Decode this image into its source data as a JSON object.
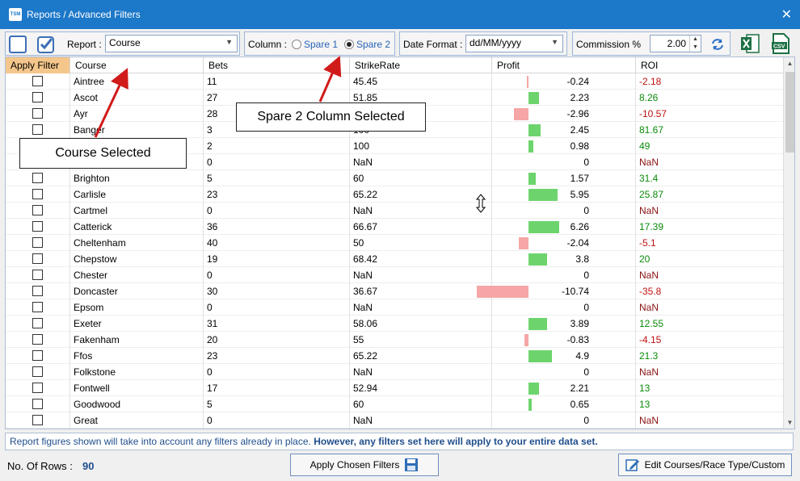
{
  "window": {
    "app_icon": "TSM",
    "title": "Reports / Advanced Filters",
    "close": "✕"
  },
  "toolbar": {
    "report_label": "Report :",
    "report_value": "Course",
    "column_label": "Column :",
    "spare1": "Spare 1",
    "spare2": "Spare 2",
    "date_format_label": "Date Format :",
    "date_format_value": "dd/MM/yyyy",
    "commission_label": "Commission %",
    "commission_value": "2.00"
  },
  "grid": {
    "headers": [
      "Apply Filter",
      "Course",
      "Bets",
      "StrikeRate",
      "Profit",
      "ROI"
    ],
    "rows": [
      {
        "course": "Aintree",
        "bets": "11",
        "strike": "45.45",
        "profit": -0.24,
        "profit_text": "-0.24",
        "roi": "-2.18"
      },
      {
        "course": "Ascot",
        "bets": "27",
        "strike": "51.85",
        "profit": 2.23,
        "profit_text": "2.23",
        "roi": "8.26"
      },
      {
        "course": "Ayr",
        "bets": "28",
        "strike": "",
        "profit": -2.96,
        "profit_text": "-2.96",
        "roi": "-10.57"
      },
      {
        "course": "Banger",
        "bets": "3",
        "strike": "100",
        "profit": 2.45,
        "profit_text": "2.45",
        "roi": "81.67"
      },
      {
        "course": "",
        "bets": "2",
        "strike": "100",
        "profit": 0.98,
        "profit_text": "0.98",
        "roi": "49"
      },
      {
        "course": "",
        "bets": "0",
        "strike": "NaN",
        "profit": 0,
        "profit_text": "0",
        "roi": "NaN"
      },
      {
        "course": "Brighton",
        "bets": "5",
        "strike": "60",
        "profit": 1.57,
        "profit_text": "1.57",
        "roi": "31.4"
      },
      {
        "course": "Carlisle",
        "bets": "23",
        "strike": "65.22",
        "profit": 5.95,
        "profit_text": "5.95",
        "roi": "25.87"
      },
      {
        "course": "Cartmel",
        "bets": "0",
        "strike": "NaN",
        "profit": 0,
        "profit_text": "0",
        "roi": "NaN"
      },
      {
        "course": "Catterick",
        "bets": "36",
        "strike": "66.67",
        "profit": 6.26,
        "profit_text": "6.26",
        "roi": "17.39"
      },
      {
        "course": "Cheltenham",
        "bets": "40",
        "strike": "50",
        "profit": -2.04,
        "profit_text": "-2.04",
        "roi": "-5.1"
      },
      {
        "course": "Chepstow",
        "bets": "19",
        "strike": "68.42",
        "profit": 3.8,
        "profit_text": "3.8",
        "roi": "20"
      },
      {
        "course": "Chester",
        "bets": "0",
        "strike": "NaN",
        "profit": 0,
        "profit_text": "0",
        "roi": "NaN"
      },
      {
        "course": "Doncaster",
        "bets": "30",
        "strike": "36.67",
        "profit": -10.74,
        "profit_text": "-10.74",
        "roi": "-35.8"
      },
      {
        "course": "Epsom",
        "bets": "0",
        "strike": "NaN",
        "profit": 0,
        "profit_text": "0",
        "roi": "NaN"
      },
      {
        "course": "Exeter",
        "bets": "31",
        "strike": "58.06",
        "profit": 3.89,
        "profit_text": "3.89",
        "roi": "12.55"
      },
      {
        "course": "Fakenham",
        "bets": "20",
        "strike": "55",
        "profit": -0.83,
        "profit_text": "-0.83",
        "roi": "-4.15"
      },
      {
        "course": "Ffos",
        "bets": "23",
        "strike": "65.22",
        "profit": 4.9,
        "profit_text": "4.9",
        "roi": "21.3"
      },
      {
        "course": "Folkstone",
        "bets": "0",
        "strike": "NaN",
        "profit": 0,
        "profit_text": "0",
        "roi": "NaN"
      },
      {
        "course": "Fontwell",
        "bets": "17",
        "strike": "52.94",
        "profit": 2.21,
        "profit_text": "2.21",
        "roi": "13"
      },
      {
        "course": "Goodwood",
        "bets": "5",
        "strike": "60",
        "profit": 0.65,
        "profit_text": "0.65",
        "roi": "13"
      },
      {
        "course": "Great",
        "bets": "0",
        "strike": "NaN",
        "profit": 0,
        "profit_text": "0",
        "roi": "NaN"
      }
    ]
  },
  "info": {
    "normal": "Report figures shown will take into account any filters already in place. ",
    "bold": "However, any filters set here will apply to your entire data set."
  },
  "footer": {
    "rows_label": "No. Of Rows  :",
    "rows_count": "90",
    "apply_button": "Apply Chosen Filters",
    "edit_button": "Edit Courses/Race Type/Custom"
  },
  "callouts": {
    "course": "Course Selected",
    "spare2": "Spare 2 Column Selected"
  },
  "colors": {
    "titlebar": "#1c78c8",
    "positive_bar": "#6dd46d",
    "negative_bar": "#f6a6a6",
    "arrow": "#d11a1a"
  },
  "icons": [
    "checkbox-empty-icon",
    "checkbox-checked-icon",
    "refresh-icon",
    "excel-icon",
    "csv-icon",
    "save-icon",
    "edit-icon",
    "resize-cursor-icon"
  ]
}
